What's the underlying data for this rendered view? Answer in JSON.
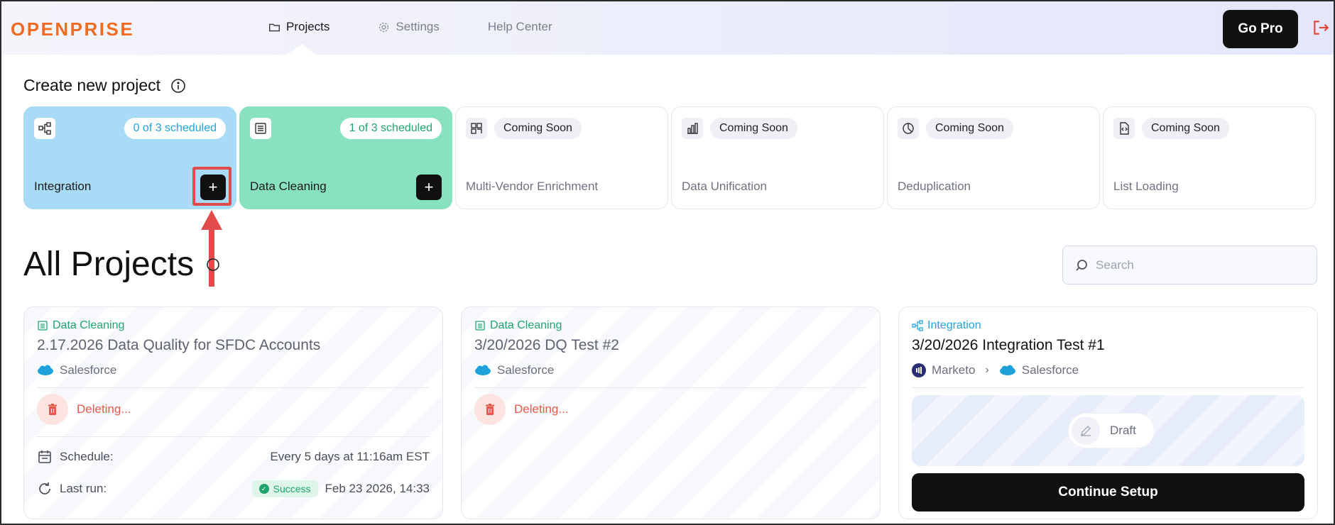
{
  "brand": {
    "logo": "OPENPRISE",
    "accent": "#ee6c24"
  },
  "nav": {
    "items": [
      {
        "label": "Projects",
        "icon": "folder-icon",
        "active": true
      },
      {
        "label": "Settings",
        "icon": "gear-icon",
        "active": false
      },
      {
        "label": "Help Center",
        "icon": "",
        "active": false
      }
    ],
    "go_pro": "Go Pro",
    "logout_icon": "logout-icon"
  },
  "create": {
    "title": "Create new project",
    "cards": [
      {
        "label": "Integration",
        "badge": "0 of 3 scheduled",
        "icon": "integration-icon",
        "add": "+"
      },
      {
        "label": "Data Cleaning",
        "badge": "1 of 3 scheduled",
        "icon": "document-list-icon",
        "add": "+"
      },
      {
        "label": "Multi-Vendor Enrichment",
        "badge": "Coming Soon",
        "icon": "grid-icon"
      },
      {
        "label": "Data Unification",
        "badge": "Coming Soon",
        "icon": "bar-chart-icon"
      },
      {
        "label": "Deduplication",
        "badge": "Coming Soon",
        "icon": "pie-icon"
      },
      {
        "label": "List Loading",
        "badge": "Coming Soon",
        "icon": "file-code-icon"
      }
    ]
  },
  "projects": {
    "title": "All Projects",
    "search_placeholder": "Search",
    "items": [
      {
        "type": "Data Cleaning",
        "title": "2.17.2026 Data Quality for SFDC Accounts",
        "source": "Salesforce",
        "status": "Deleting...",
        "schedule_label": "Schedule:",
        "schedule_value": "Every 5 days at 11:16am EST",
        "lastrun_label": "Last run:",
        "lastrun_status": "Success",
        "lastrun_value": "Feb 23 2026, 14:33"
      },
      {
        "type": "Data Cleaning",
        "title": "3/20/2026 DQ Test #2",
        "source": "Salesforce",
        "status": "Deleting..."
      },
      {
        "type": "Integration",
        "title": "3/20/2026 Integration Test #1",
        "source": "Marketo",
        "target": "Salesforce",
        "status": "Draft",
        "action": "Continue Setup"
      }
    ]
  },
  "colors": {
    "integration_card": "#a7dbf6",
    "cleaning_card": "#89e2bf",
    "integration_text": "#21a3dc",
    "cleaning_text": "#1fa46c",
    "danger": "#e25a4a",
    "highlight": "#e14b4b"
  }
}
